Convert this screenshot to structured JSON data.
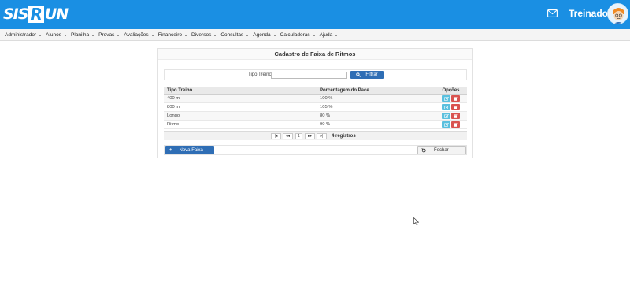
{
  "brand": {
    "logo_left": "SIS",
    "logo_box": "R",
    "logo_right": "UN"
  },
  "header": {
    "username": "Treinador"
  },
  "menu": [
    {
      "label": "Administrador"
    },
    {
      "label": "Alunos"
    },
    {
      "label": "Planilha"
    },
    {
      "label": "Provas"
    },
    {
      "label": "Avaliações"
    },
    {
      "label": "Financeiro"
    },
    {
      "label": "Diversos"
    },
    {
      "label": "Consultas"
    },
    {
      "label": "Agenda"
    },
    {
      "label": "Calculadoras"
    },
    {
      "label": "Ajuda"
    }
  ],
  "panel": {
    "title": "Cadastro de Faixa de Ritmos"
  },
  "filter": {
    "label": "Tipo Treino",
    "value": "",
    "button": "Filtrar"
  },
  "table": {
    "headers": [
      "Tipo Treino",
      "Porcentagem do Pace",
      "Opções"
    ],
    "rows": [
      {
        "tipo": "400 m",
        "pct": "100 %"
      },
      {
        "tipo": "800 m",
        "pct": "105 %"
      },
      {
        "tipo": "Longo",
        "pct": "80 %"
      },
      {
        "tipo": "Ritmo",
        "pct": "90 %"
      }
    ]
  },
  "pager": {
    "first": "|◂",
    "prev": "◂◂",
    "current": "1",
    "next": "▸▸",
    "last": "▸|",
    "count": "4 registros"
  },
  "actions": {
    "new": "Nova Faixa",
    "close": "Fechar"
  },
  "colors": {
    "header": "#1a8fe3",
    "primary_button": "#2f6eb5",
    "edit": "#5bc0de",
    "delete": "#d9534f"
  }
}
